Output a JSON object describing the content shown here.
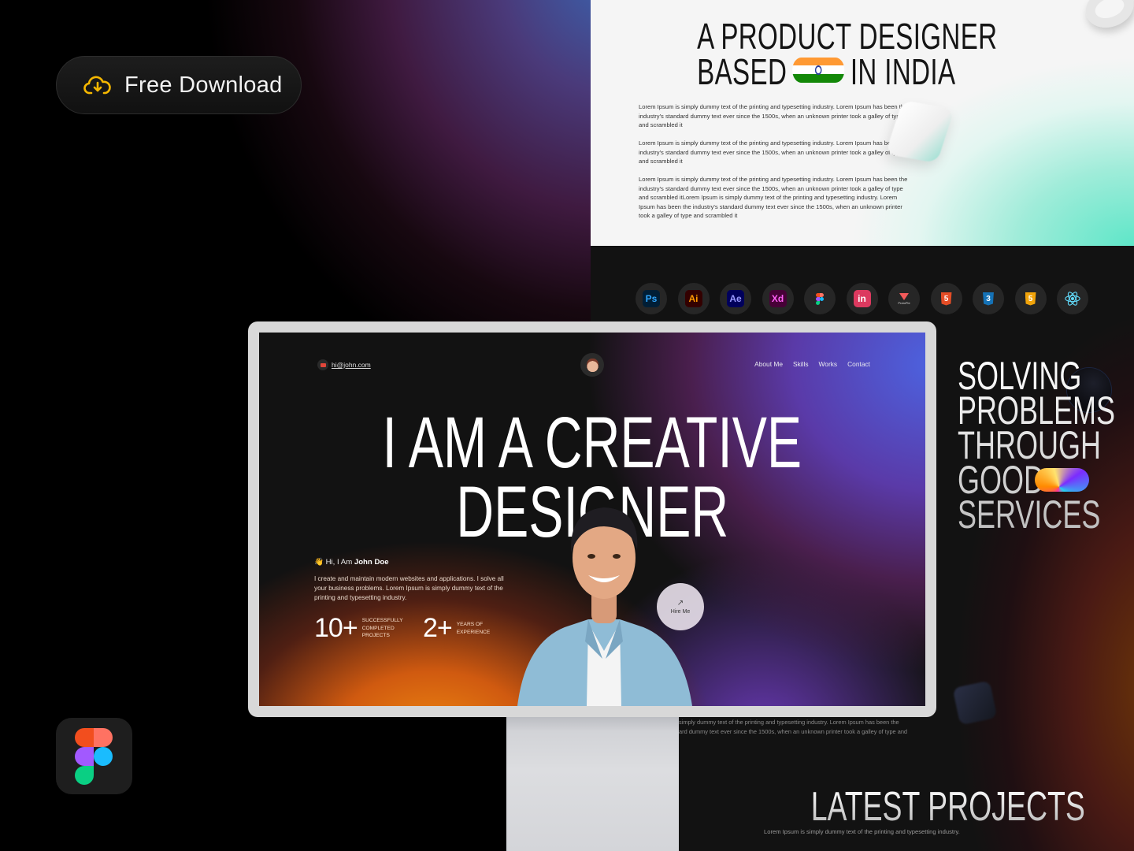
{
  "promo": {
    "download_button": {
      "label": "Free Download",
      "icon": "cloud-download-icon",
      "icon_color": "#F5B700"
    },
    "figma_badge": {
      "icon": "figma-logo-icon"
    }
  },
  "about_panel": {
    "title_line1": "A PRODUCT DESIGNER",
    "title_line2_before": "BASED",
    "title_line2_after": "IN INDIA",
    "flag": "india-flag",
    "paragraphs": [
      "Lorem Ipsum is simply dummy text of the printing and typesetting industry. Lorem Ipsum has been the industry's standard dummy text ever since the 1500s, when an unknown printer took a galley of type and scrambled it",
      "Lorem Ipsum is simply dummy text of the printing and typesetting industry. Lorem Ipsum has been the industry's standard dummy text ever since the 1500s, when an unknown printer took a galley of type and scrambled it",
      "Lorem Ipsum is simply dummy text of the printing and typesetting industry. Lorem Ipsum has been the industry's standard dummy text ever since the 1500s, when an unknown printer took a galley of type and scrambled itLorem Ipsum is simply dummy text of the printing and typesetting industry. Lorem Ipsum has been the industry's standard dummy text ever since the 1500s, when an unknown printer took a galley of type and scrambled it"
    ]
  },
  "skills": {
    "tools": [
      {
        "name": "photoshop",
        "label": "Ps",
        "fg": "#31A8FF",
        "bg": "#001E36"
      },
      {
        "name": "illustrator",
        "label": "Ai",
        "fg": "#FF9A00",
        "bg": "#330000"
      },
      {
        "name": "after-effects",
        "label": "Ae",
        "fg": "#9999FF",
        "bg": "#00005B"
      },
      {
        "name": "xd",
        "label": "Xd",
        "fg": "#FF61F6",
        "bg": "#470137"
      },
      {
        "name": "figma",
        "label": "",
        "fg": "",
        "bg": ""
      },
      {
        "name": "invision",
        "label": "in",
        "fg": "#FFFFFF",
        "bg": "#DC395F"
      },
      {
        "name": "protopie",
        "label": "ProtoPie",
        "fg": "#F25A5A",
        "bg": ""
      },
      {
        "name": "html5",
        "label": "5",
        "fg": "#FFFFFF",
        "bg": "#E44D26"
      },
      {
        "name": "css3",
        "label": "3",
        "fg": "#FFFFFF",
        "bg": "#1572B6"
      },
      {
        "name": "javascript",
        "label": "5",
        "fg": "#FFFFFF",
        "bg": "#F0A30A"
      },
      {
        "name": "react",
        "label": "",
        "fg": "#61DAFB",
        "bg": ""
      }
    ]
  },
  "services": {
    "lines": [
      "SOLVING",
      "PROBLEMS",
      "THROUGH",
      "GOOD",
      "SERVICES"
    ]
  },
  "projects": {
    "snippet_line1": "simply dummy text of the printing and typesetting industry. Lorem Ipsum has been the",
    "snippet_line2": "ard dummy text ever since the 1500s, when an unknown printer took a galley of type and",
    "title": "LATEST PROJECTS",
    "subtitle": "Lorem Ipsum is simply dummy text of the printing and typesetting industry."
  },
  "site": {
    "email": "hi@john.com",
    "nav": [
      "About Me",
      "Skills",
      "Works",
      "Contact"
    ],
    "hero_line1": "I AM A CREATIVE",
    "hero_line2": "DESIGNER",
    "greeting_prefix": "👋 Hi, I Am ",
    "name": "John Doe",
    "intro": "I create and maintain modern websites and applications. I solve all your business problems. Lorem Ipsum is simply dummy text of the printing and typesetting industry.",
    "stats": [
      {
        "value": "10+",
        "label_lines": [
          "SUCCESSFULLY",
          "COMPLETED",
          "PROJECTS"
        ]
      },
      {
        "value": "2+",
        "label_lines": [
          "YEARS OF",
          "EXPERIENCE"
        ]
      }
    ],
    "hire_button": {
      "label": "Hire Me",
      "icon": "↗"
    }
  }
}
